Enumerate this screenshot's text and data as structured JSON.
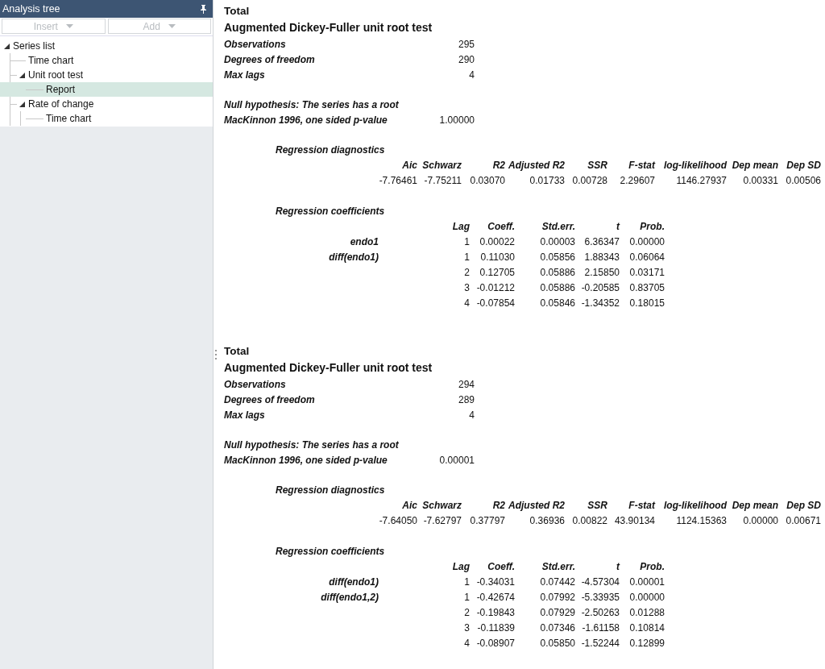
{
  "sidebar": {
    "title": "Analysis tree",
    "toolbar": [
      {
        "label": "Insert",
        "disabled": true
      },
      {
        "label": "Add",
        "disabled": true
      }
    ],
    "tree": [
      {
        "label": "Series list",
        "expanded": true,
        "selected": false,
        "children": [
          {
            "label": "Time chart",
            "selected": false
          },
          {
            "label": "Unit root test",
            "expanded": true,
            "selected": false,
            "children": [
              {
                "label": "Report",
                "selected": true
              }
            ]
          },
          {
            "label": "Rate of change",
            "expanded": true,
            "selected": false,
            "children": [
              {
                "label": "Time chart",
                "selected": false
              }
            ]
          }
        ]
      }
    ]
  },
  "reports": [
    {
      "title": "Total",
      "test_title": "Augmented Dickey-Fuller unit root test",
      "summary": [
        {
          "label": "Observations",
          "value": "295"
        },
        {
          "label": "Degrees of freedom",
          "value": "290"
        },
        {
          "label": "Max lags",
          "value": "4"
        }
      ],
      "null_hypothesis": "Null hypothesis: The series has a root",
      "p_value": {
        "label": "MacKinnon 1996, one sided p-value",
        "value": "1.00000"
      },
      "diagnostics": {
        "title": "Regression diagnostics",
        "columns": [
          "Aic",
          "Schwarz",
          "R2",
          "Adjusted R2",
          "SSR",
          "F-stat",
          "log-likelihood",
          "Dep mean",
          "Dep SD"
        ],
        "values": [
          "-7.76461",
          "-7.75211",
          "0.03070",
          "0.01733",
          "0.00728",
          "2.29607",
          "1146.27937",
          "0.00331",
          "0.00506"
        ]
      },
      "coefficients": {
        "title": "Regression coefficients",
        "columns": [
          "Lag",
          "Coeff.",
          "Std.err.",
          "t",
          "Prob."
        ],
        "rows": [
          {
            "variable": "endo1",
            "lag": "1",
            "coeff": "0.00022",
            "stderr": "0.00003",
            "t": "6.36347",
            "prob": "0.00000"
          },
          {
            "variable": "diff(endo1)",
            "lag": "1",
            "coeff": "0.11030",
            "stderr": "0.05856",
            "t": "1.88343",
            "prob": "0.06064"
          },
          {
            "lag": "2",
            "coeff": "0.12705",
            "stderr": "0.05886",
            "t": "2.15850",
            "prob": "0.03171"
          },
          {
            "lag": "3",
            "coeff": "-0.01212",
            "stderr": "0.05886",
            "t": "-0.20585",
            "prob": "0.83705"
          },
          {
            "lag": "4",
            "coeff": "-0.07854",
            "stderr": "0.05846",
            "t": "-1.34352",
            "prob": "0.18015"
          }
        ]
      }
    },
    {
      "title": "Total",
      "test_title": "Augmented Dickey-Fuller unit root test",
      "summary": [
        {
          "label": "Observations",
          "value": "294"
        },
        {
          "label": "Degrees of freedom",
          "value": "289"
        },
        {
          "label": "Max lags",
          "value": "4"
        }
      ],
      "null_hypothesis": "Null hypothesis: The series has a root",
      "p_value": {
        "label": "MacKinnon 1996, one sided p-value",
        "value": "0.00001"
      },
      "diagnostics": {
        "title": "Regression diagnostics",
        "columns": [
          "Aic",
          "Schwarz",
          "R2",
          "Adjusted R2",
          "SSR",
          "F-stat",
          "log-likelihood",
          "Dep mean",
          "Dep SD"
        ],
        "values": [
          "-7.64050",
          "-7.62797",
          "0.37797",
          "0.36936",
          "0.00822",
          "43.90134",
          "1124.15363",
          "0.00000",
          "0.00671"
        ]
      },
      "coefficients": {
        "title": "Regression coefficients",
        "columns": [
          "Lag",
          "Coeff.",
          "Std.err.",
          "t",
          "Prob."
        ],
        "rows": [
          {
            "variable": "diff(endo1)",
            "lag": "1",
            "coeff": "-0.34031",
            "stderr": "0.07442",
            "t": "-4.57304",
            "prob": "0.00001"
          },
          {
            "variable": "diff(endo1,2)",
            "lag": "1",
            "coeff": "-0.42674",
            "stderr": "0.07992",
            "t": "-5.33935",
            "prob": "0.00000"
          },
          {
            "lag": "2",
            "coeff": "-0.19843",
            "stderr": "0.07929",
            "t": "-2.50263",
            "prob": "0.01288"
          },
          {
            "lag": "3",
            "coeff": "-0.11839",
            "stderr": "0.07346",
            "t": "-1.61158",
            "prob": "0.10814"
          },
          {
            "lag": "4",
            "coeff": "-0.08907",
            "stderr": "0.05850",
            "t": "-1.52244",
            "prob": "0.12899"
          }
        ]
      }
    }
  ]
}
